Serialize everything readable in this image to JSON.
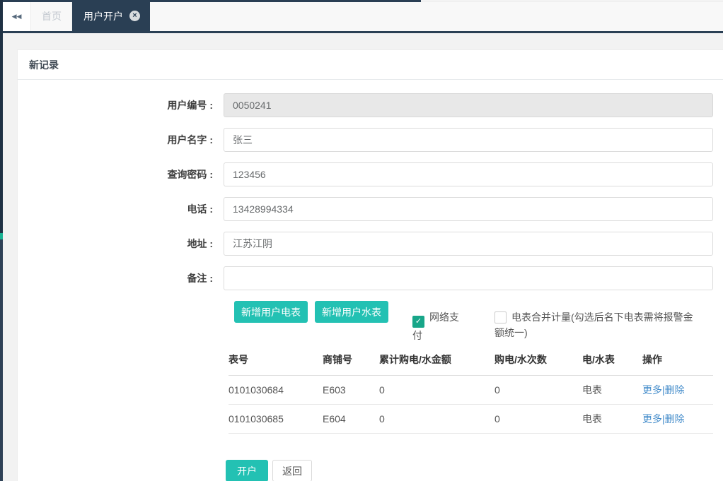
{
  "colors": {
    "navy": "#2a3f54",
    "sidebar_dark": "#1f3144",
    "sidebar_light": "#2e4156",
    "teal_accent": "#1ab394",
    "teal_button": "#23c1b3",
    "check_green": "#18a689",
    "link_blue": "#428bca"
  },
  "icons": {
    "collapse_tabs": "◀◀",
    "close": "×",
    "check": "✓"
  },
  "tabbar": {
    "tabs": [
      {
        "label": "首页",
        "active": false
      },
      {
        "label": "用户开户",
        "active": true,
        "closable": true
      }
    ]
  },
  "panel": {
    "title": "新记录"
  },
  "form": {
    "fields": [
      {
        "label": "用户编号 :",
        "value": "0050241",
        "disabled": true
      },
      {
        "label": "用户名字 :",
        "value": "张三",
        "disabled": false
      },
      {
        "label": "查询密码 :",
        "value": "123456",
        "disabled": false
      },
      {
        "label": "电话 :",
        "value": "13428994334",
        "disabled": false
      },
      {
        "label": "地址 :",
        "value": "江苏江阴",
        "disabled": false
      },
      {
        "label": "备注 :",
        "value": "",
        "disabled": false
      }
    ]
  },
  "actions": {
    "add_electric_meter": "新增用户电表",
    "add_water_meter": "新增用户水表",
    "open_account": "开户",
    "back": "返回"
  },
  "checkboxes": [
    {
      "label": "网络支付",
      "checked": true
    },
    {
      "label": "电表合并计量(勾选后名下电表需将报警金额统一)",
      "checked": false
    }
  ],
  "meter_table": {
    "headers": [
      "表号",
      "商铺号",
      "累计购电/水金额",
      "购电/水次数",
      "电/水表",
      "操作"
    ],
    "row_actions": {
      "more": "更多",
      "separator": "|",
      "delete": "删除"
    },
    "rows": [
      {
        "meter_no": "0101030684",
        "shop_no": "E603",
        "total_amount": "0",
        "times": "0",
        "type": "电表"
      },
      {
        "meter_no": "0101030685",
        "shop_no": "E604",
        "total_amount": "0",
        "times": "0",
        "type": "电表"
      }
    ]
  }
}
